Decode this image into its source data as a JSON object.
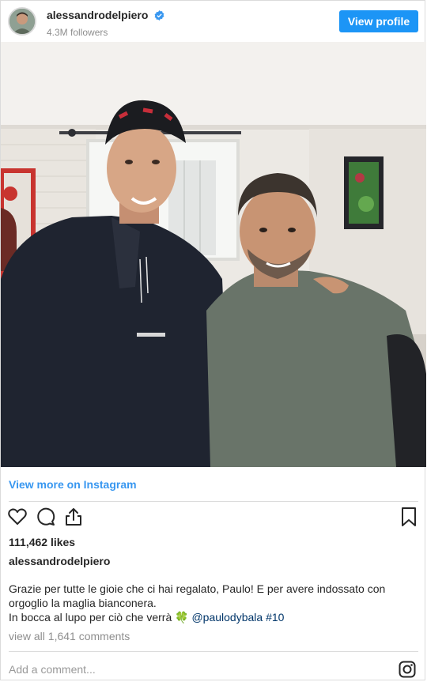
{
  "header": {
    "username": "alessandrodelpiero",
    "followers": "4.3M followers",
    "view_profile_label": "View profile"
  },
  "post": {
    "view_more_label": "View more on Instagram",
    "likes": "111,462 likes",
    "author": "alessandrodelpiero",
    "caption_line1": "Grazie per tutte le gioie che ci hai regalato, Paulo! E per avere indossato con orgoglio la maglia bianconera.",
    "caption_line2": "In bocca al lupo per ciò che verrà",
    "caption_emoji": "🍀",
    "caption_mention": "@paulodybala",
    "caption_hashtag": "#10",
    "comments_label": "view all 1,641 comments",
    "add_comment_placeholder": "Add a comment..."
  },
  "icons": {
    "verified": "verified-badge-icon",
    "like": "heart-icon",
    "comment": "comment-icon",
    "share": "share-icon",
    "save": "bookmark-icon",
    "instagram": "instagram-icon"
  },
  "colors": {
    "accent": "#1c95f6",
    "link": "#3897f0",
    "muted": "#8e8e8e"
  }
}
